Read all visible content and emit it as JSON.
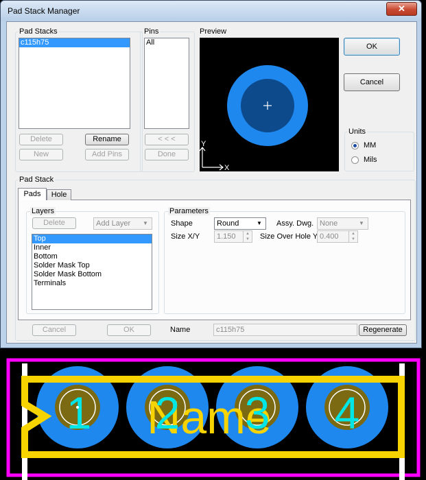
{
  "window": {
    "title": "Pad Stack Manager",
    "close_glyph": "✕"
  },
  "pad_stacks": {
    "label": "Pad Stacks",
    "items": [
      "c115h75"
    ],
    "delete": "Delete",
    "rename": "Rename",
    "new": "New",
    "add_pins": "Add Pins"
  },
  "pins": {
    "label": "Pins",
    "items": [
      "All"
    ],
    "back": "< < <",
    "done": "Done"
  },
  "preview": {
    "label": "Preview",
    "axis_x": "X",
    "axis_y": "Y"
  },
  "dialog": {
    "ok": "OK",
    "cancel": "Cancel"
  },
  "units": {
    "label": "Units",
    "options": [
      "MM",
      "Mils"
    ],
    "selected": "MM"
  },
  "pad_stack": {
    "label": "Pad Stack",
    "tabs": [
      "Pads",
      "Hole"
    ],
    "active_tab": "Pads",
    "layers": {
      "label": "Layers",
      "delete": "Delete",
      "add_layer": "Add Layer",
      "items": [
        "Top",
        "Inner",
        "Bottom",
        "Solder Mask Top",
        "Solder Mask Bottom",
        "Terminals"
      ],
      "selected": "Top"
    },
    "parameters": {
      "label": "Parameters",
      "shape_label": "Shape",
      "shape_value": "Round",
      "assy_label": "Assy. Dwg.",
      "assy_value": "None",
      "size_label": "Size X/Y",
      "size_value": "1.150",
      "over_hole_label": "Size Over Hole Y",
      "over_hole_value": "0.400"
    },
    "cancel": "Cancel",
    "ok": "OK",
    "name_label": "Name",
    "name_value": "c115h75",
    "regenerate": "Regenerate"
  },
  "footprint": {
    "pins": [
      "1",
      "2",
      "3",
      "4"
    ],
    "name_text": "Name"
  },
  "colors": {
    "pad_outer": "#1e88ef",
    "pad_inner": "#7b6a12",
    "silkscreen": "#f7d300",
    "courtyard": "#ff00ff",
    "pin_number": "#00e5e5",
    "preview_bg": "#000000"
  }
}
